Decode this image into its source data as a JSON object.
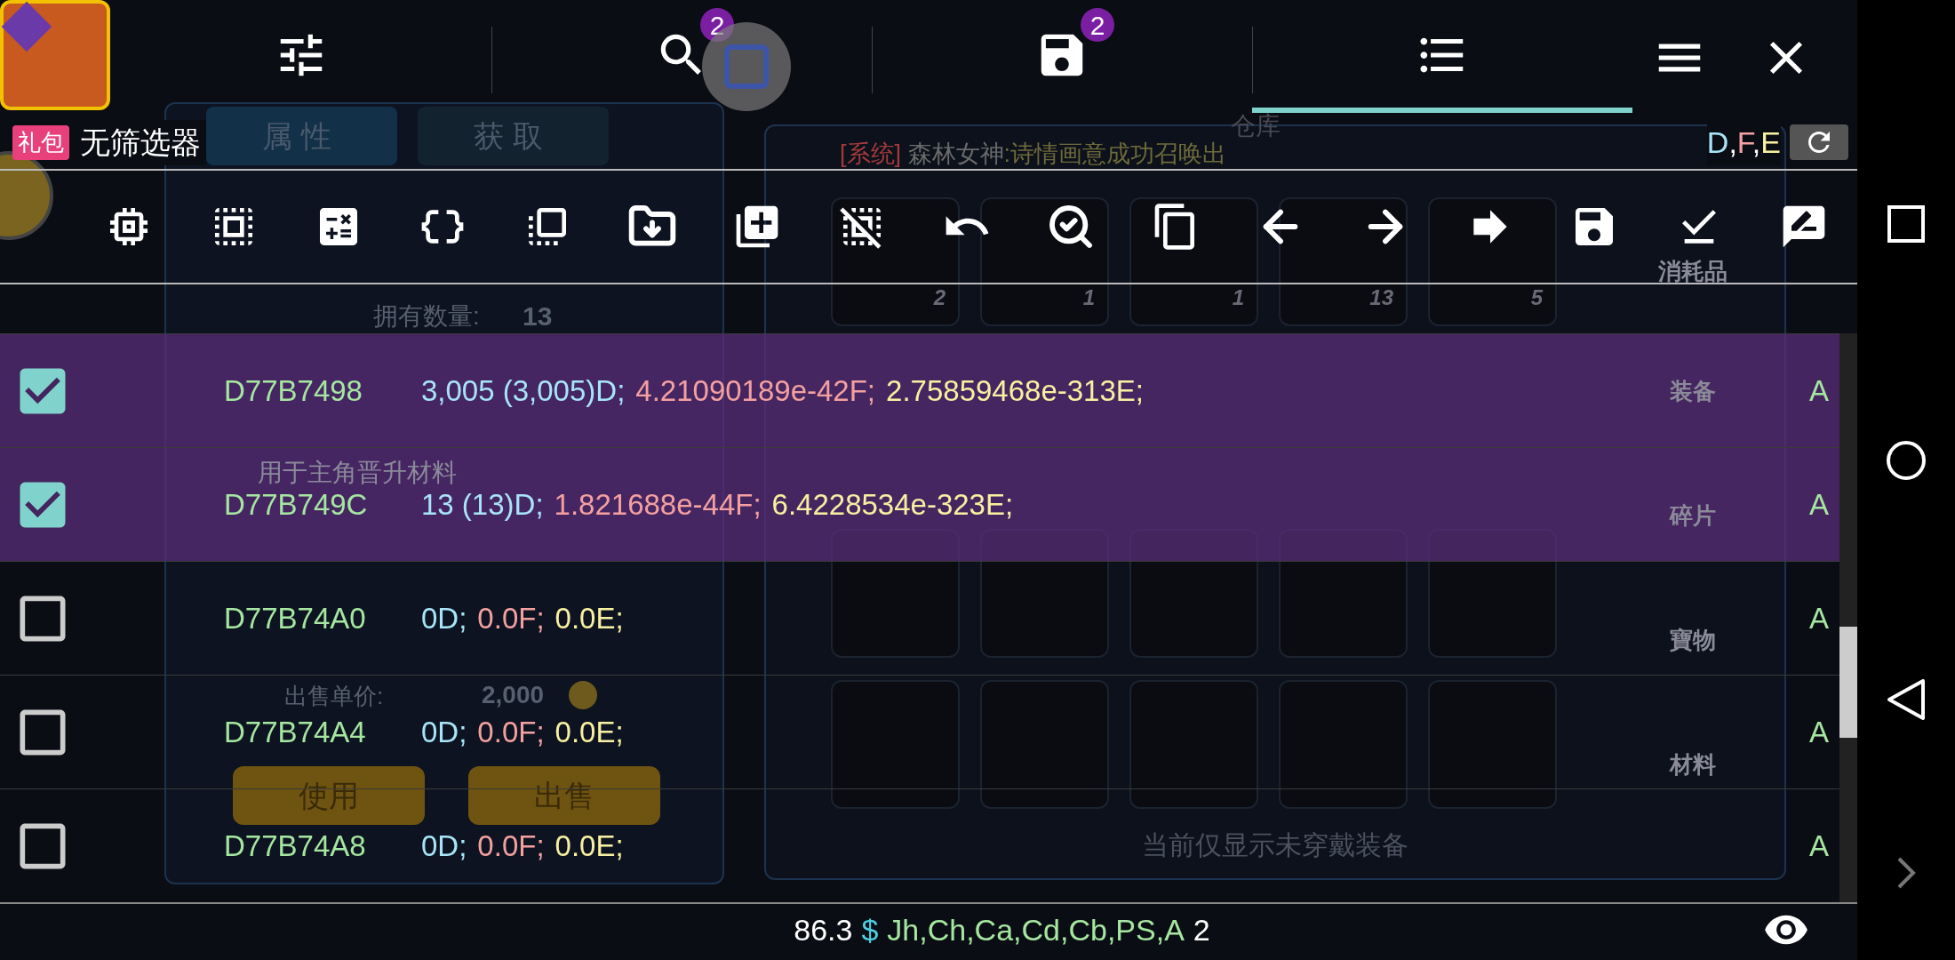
{
  "game": {
    "tabs": [
      "属性",
      "获取"
    ],
    "title": "仓库",
    "system_message": [
      {
        "text": "[系统]",
        "color": "#a33a3a"
      },
      {
        "text": " 森林女神",
        "color": "#6a6a6a"
      },
      {
        "text": ":诗情画意成功召唤出",
        "color": "#6e6a3a"
      }
    ],
    "owned_label": "拥有数量:",
    "owned_value": "13",
    "description": "用于主角晋升材料",
    "price_label": "出售单价:",
    "price_value": "2,000",
    "buttons": [
      "使用",
      "出售"
    ],
    "item_counts": [
      "2",
      "1",
      "1",
      "13",
      "5"
    ],
    "footer_note": "当前仅显示未穿戴装备",
    "categories": [
      "消耗品",
      "装备",
      "碎片",
      "寶物",
      "材料"
    ]
  },
  "tabs": [
    {
      "kind": "settings",
      "selected": false
    },
    {
      "kind": "search",
      "badge": "2",
      "selected": false
    },
    {
      "kind": "saved",
      "badge": "2",
      "selected": false
    },
    {
      "kind": "list",
      "selected": true
    }
  ],
  "header_buttons": [
    {
      "kind": "menu"
    },
    {
      "kind": "close"
    }
  ],
  "filter": {
    "badge": "礼包",
    "label": "无筛选器"
  },
  "value_types": [
    {
      "text": "D",
      "color": "#a8e4f8"
    },
    {
      "text": ",",
      "color": "#ffffff"
    },
    {
      "text": "F",
      "color": "#f4a0a0"
    },
    {
      "text": ",",
      "color": "#ffffff"
    },
    {
      "text": "E",
      "color": "#f8f0a0"
    }
  ],
  "toolbar": [
    {
      "kind": "chip"
    },
    {
      "kind": "select-all"
    },
    {
      "kind": "calculator"
    },
    {
      "kind": "braces"
    },
    {
      "kind": "layers"
    },
    {
      "kind": "folder-down"
    },
    {
      "kind": "copy-plus"
    },
    {
      "kind": "deselect"
    },
    {
      "kind": "undo"
    },
    {
      "kind": "search-check"
    },
    {
      "kind": "copy"
    },
    {
      "kind": "arrow-left"
    },
    {
      "kind": "arrow-right"
    },
    {
      "kind": "forward"
    },
    {
      "kind": "save"
    },
    {
      "kind": "download-check"
    },
    {
      "kind": "rate-review"
    }
  ],
  "rows": [
    {
      "checked": true,
      "address": "D77B7498",
      "values": [
        {
          "text": "3,005 (3,005)D;",
          "color": "#a8e4f8"
        },
        {
          "text": "4.21090189e-42F;",
          "color": "#f4a0a0"
        },
        {
          "text": "2.75859468e-313E;",
          "color": "#f8f0a0"
        }
      ],
      "flag": "A"
    },
    {
      "checked": true,
      "address": "D77B749C",
      "values": [
        {
          "text": "13 (13)D;",
          "color": "#a8e4f8"
        },
        {
          "text": "1.821688e-44F;",
          "color": "#f4a0a0"
        },
        {
          "text": "6.4228534e-323E;",
          "color": "#f8f0a0"
        }
      ],
      "flag": "A"
    },
    {
      "checked": false,
      "address": "D77B74A0",
      "values": [
        {
          "text": "0D;",
          "color": "#a8e4f8"
        },
        {
          "text": "0.0F;",
          "color": "#f4a0a0"
        },
        {
          "text": "0.0E;",
          "color": "#f8f0a0"
        }
      ],
      "flag": "A"
    },
    {
      "checked": false,
      "address": "D77B74A4",
      "values": [
        {
          "text": "0D;",
          "color": "#a8e4f8"
        },
        {
          "text": "0.0F;",
          "color": "#f4a0a0"
        },
        {
          "text": "0.0E;",
          "color": "#f8f0a0"
        }
      ],
      "flag": "A"
    },
    {
      "checked": false,
      "address": "D77B74A8",
      "values": [
        {
          "text": "0D;",
          "color": "#a8e4f8"
        },
        {
          "text": "0.0F;",
          "color": "#f4a0a0"
        },
        {
          "text": "0.0E;",
          "color": "#f8f0a0"
        }
      ],
      "flag": "A"
    }
  ],
  "status": [
    {
      "text": "86.3",
      "color": "#ffffff"
    },
    {
      "text": "$",
      "color": "#4dd0e1"
    },
    {
      "text": "Jh,Ch,Ca,Cd,Cb,PS,A",
      "color": "#a5e6a0"
    },
    {
      "text": "2",
      "color": "#ffffff"
    }
  ]
}
